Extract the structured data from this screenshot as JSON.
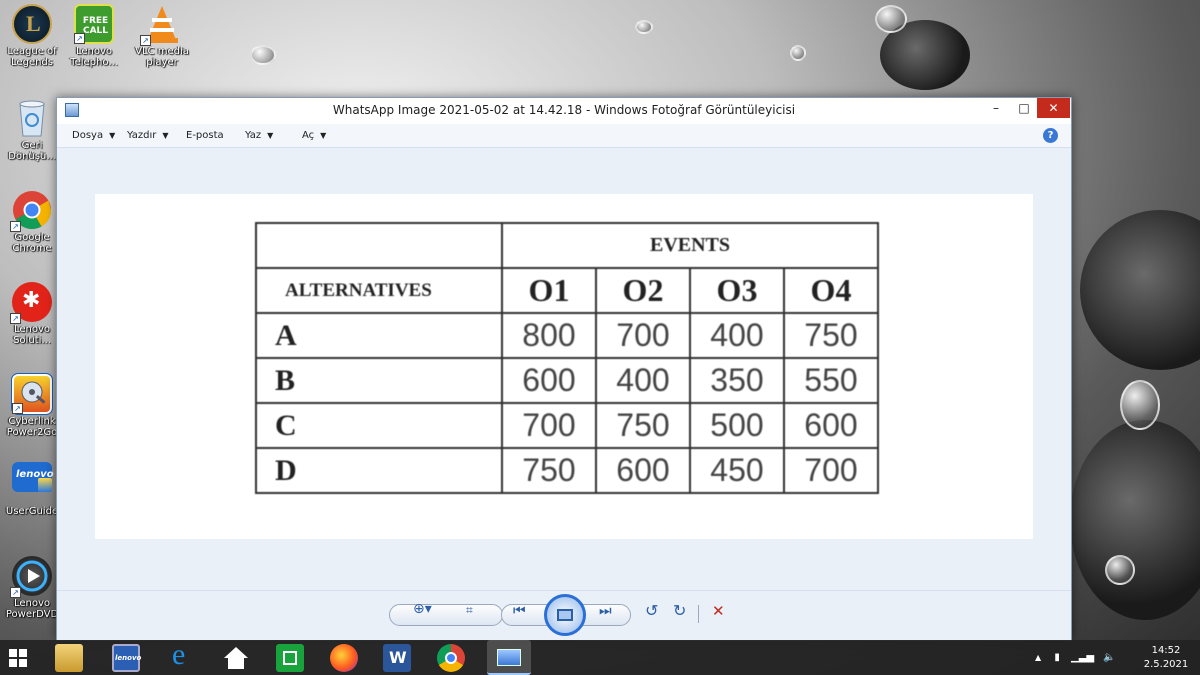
{
  "desktop": {
    "icons": [
      {
        "label": "League of\nLegends",
        "icon": "league-of-legends-icon"
      },
      {
        "label": "Lenovo\nTelepho...",
        "icon": "lenovo-telephony-icon",
        "badge": "FREE CALL"
      },
      {
        "label": "VLC media\nplayer",
        "icon": "vlc-icon"
      },
      {
        "label": "Geri\nDönüşü...",
        "icon": "recycle-bin-icon"
      },
      {
        "label": "Google\nChrome",
        "icon": "chrome-icon"
      },
      {
        "label": "Lenovo\nSoluti...",
        "icon": "lenovo-solutions-icon"
      },
      {
        "label": "Cyberlink\nPower2Go",
        "icon": "power2go-icon"
      },
      {
        "label": "UserGuide",
        "icon": "lenovo-userguide-icon",
        "logo_text": "lenovo"
      },
      {
        "label": "Lenovo\nPowerDVD",
        "icon": "powerdvd-icon"
      }
    ]
  },
  "window": {
    "title": "WhatsApp Image 2021-05-02 at 14.42.18 - Windows Fotoğraf Görüntüleyicisi",
    "controls": {
      "minimize": "–",
      "maximize": "□",
      "close": "✕"
    },
    "menu": [
      {
        "label": "Dosya",
        "has_caret": true
      },
      {
        "label": "Yazdır",
        "has_caret": true
      },
      {
        "label": "E-posta",
        "has_caret": false
      },
      {
        "label": "Yaz",
        "has_caret": true
      },
      {
        "label": "Aç",
        "has_caret": true
      }
    ],
    "help": "?",
    "image_table": {
      "events_header": "EVENTS",
      "alternatives_header": "ALTERNATIVES",
      "columns": [
        "O1",
        "O2",
        "O3",
        "O4"
      ],
      "rows": [
        {
          "label": "A",
          "values": [
            "800",
            "700",
            "400",
            "750"
          ]
        },
        {
          "label": "B",
          "values": [
            "600",
            "400",
            "350",
            "550"
          ]
        },
        {
          "label": "C",
          "values": [
            "700",
            "750",
            "500",
            "600"
          ]
        },
        {
          "label": "D",
          "values": [
            "750",
            "600",
            "450",
            "700"
          ]
        }
      ]
    },
    "toolbar": {
      "zoom": "⊕▾",
      "actual_size": "⌗",
      "prev": "⏮",
      "next": "⏭",
      "rotate_ccw": "↺",
      "rotate_cw": "↻",
      "delete": "✕"
    }
  },
  "taskbar": {
    "apps": [
      "file-explorer-icon",
      "lenovo-monitor-icon",
      "internet-explorer-icon",
      "home-icon",
      "store-icon",
      "firefox-icon",
      "word-icon",
      "chrome-icon",
      "photo-viewer-icon"
    ],
    "word_letter": "W",
    "ie_letter": "e",
    "lenovo_text": "lenovo",
    "clock_time": "14:52",
    "clock_date": "2.5.2021",
    "tray_chevron": "▲"
  }
}
